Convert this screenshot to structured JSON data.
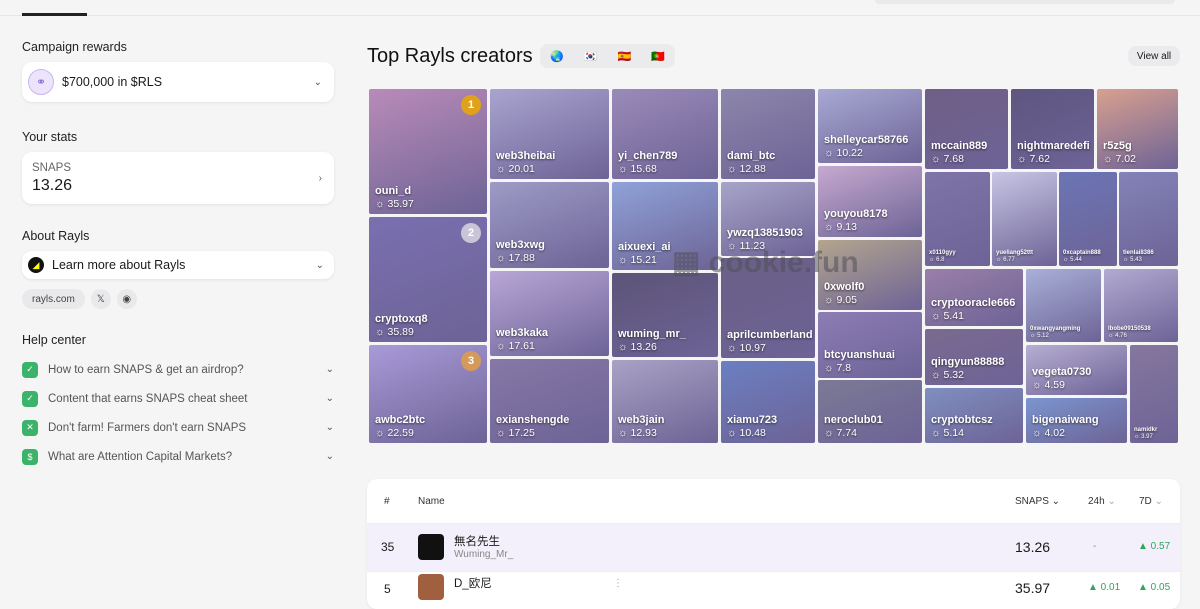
{
  "sidebar": {
    "campaign_label": "Campaign rewards",
    "reward": "$700,000 in $RLS",
    "stats_label": "Your stats",
    "snaps_label": "SNAPS",
    "snaps_value": "13.26",
    "about_label": "About Rayls",
    "about_link": "Learn more about Rayls",
    "site": "rayls.com",
    "help_label": "Help center",
    "help_items": [
      "How to earn SNAPS & get an airdrop?",
      "Content that earns SNAPS cheat sheet",
      "Don't farm! Farmers don't earn SNAPS",
      "What are Attention Capital Markets?"
    ]
  },
  "main": {
    "title": "Top Rayls creators",
    "view_all": "View all",
    "flags": [
      "🌏",
      "🇰🇷",
      "🇪🇸",
      "🇵🇹"
    ],
    "watermark": "cookie.fun"
  },
  "creators": [
    {
      "name": "ouni_d",
      "score": "35.97",
      "rank": "1",
      "color": "#b98bb8"
    },
    {
      "name": "cryptoxq8",
      "score": "35.89",
      "rank": "2",
      "color": "#7a6fb0"
    },
    {
      "name": "awbc2btc",
      "score": "22.59",
      "rank": "3",
      "color": "#a99ad8"
    },
    {
      "name": "web3heibai",
      "score": "20.01",
      "color": "#a9a4cf"
    },
    {
      "name": "web3xwg",
      "score": "17.88",
      "color": "#9d9bc6"
    },
    {
      "name": "web3kaka",
      "score": "17.61",
      "color": "#b8a6d6"
    },
    {
      "name": "exianshengde",
      "score": "17.25",
      "color": "#8678a6"
    },
    {
      "name": "yi_chen789",
      "score": "15.68",
      "color": "#9a8ab8"
    },
    {
      "name": "aixuexi_ai",
      "score": "15.21",
      "color": "#8fa2d8"
    },
    {
      "name": "wuming_mr_",
      "score": "13.26",
      "color": "#5d5478"
    },
    {
      "name": "web3jain",
      "score": "12.93",
      "color": "#a9a2c4"
    },
    {
      "name": "dami_btc",
      "score": "12.88",
      "color": "#8d86ab"
    },
    {
      "name": "ywzq13851903",
      "score": "11.23",
      "color": "#a7a4c8"
    },
    {
      "name": "aprilcumberland",
      "score": "10.97",
      "color": "#6a5f86"
    },
    {
      "name": "xiamu723",
      "score": "10.48",
      "color": "#6b7fc2"
    },
    {
      "name": "shelleycar58766",
      "score": "10.22",
      "color": "#a8a9d4"
    },
    {
      "name": "youyou8178",
      "score": "9.13",
      "color": "#c6a9cf"
    },
    {
      "name": "0xwolf0",
      "score": "9.05",
      "color": "#b3a58e"
    },
    {
      "name": "btcyuanshuai",
      "score": "7.8",
      "color": "#8c7db5"
    },
    {
      "name": "neroclub01",
      "score": "7.74",
      "color": "#7b7a95"
    },
    {
      "name": "mccain889",
      "score": "7.68",
      "color": "#6e5f86"
    },
    {
      "name": "nightmaredefi",
      "score": "7.62",
      "color": "#5f5580"
    },
    {
      "name": "r5z5g",
      "score": "7.02",
      "color": "#d9a08f"
    },
    {
      "name": "x0110gyy",
      "score": "6.8",
      "color": "#7e74a8"
    },
    {
      "name": "yueliang52ttt",
      "score": "6.77",
      "color": "#c7c5e4"
    },
    {
      "name": "0xcaptain888",
      "score": "5.44",
      "color": "#6c75b5"
    },
    {
      "name": "tienlai8386",
      "score": "5.43",
      "color": "#8383b8"
    },
    {
      "name": "cryptooracle666",
      "score": "5.41",
      "color": "#9a7fa8"
    },
    {
      "name": "0xwangyangming",
      "score": "5.12",
      "color": "#a8b0d8"
    },
    {
      "name": "lbobe09150538",
      "score": "4.76",
      "color": "#b2aad2"
    },
    {
      "name": "qingyun88888",
      "score": "5.32",
      "color": "#7a6a90"
    },
    {
      "name": "cryptobtcsz",
      "score": "5.14",
      "color": "#7f8fc0"
    },
    {
      "name": "vegeta0730",
      "score": "4.59",
      "color": "#b7aed3"
    },
    {
      "name": "bigenaiwang",
      "score": "4.02",
      "color": "#7b95cf"
    },
    {
      "name": "namidkr",
      "score": "3.97",
      "color": "#85779e"
    }
  ],
  "table": {
    "headers": {
      "rank": "#",
      "name": "Name",
      "snaps": "SNAPS",
      "h24": "24h",
      "d7": "7D"
    },
    "rows": [
      {
        "rank": "35",
        "name": "無名先生",
        "handle": "Wuming_Mr_",
        "snaps": "13.26",
        "h24": "-",
        "d7": "▲ 0.57"
      },
      {
        "rank": "5",
        "name": "D_欧尼",
        "handle": "",
        "snaps": "35.97",
        "h24": "▲ 0.01",
        "d7": "▲ 0.05"
      }
    ]
  }
}
